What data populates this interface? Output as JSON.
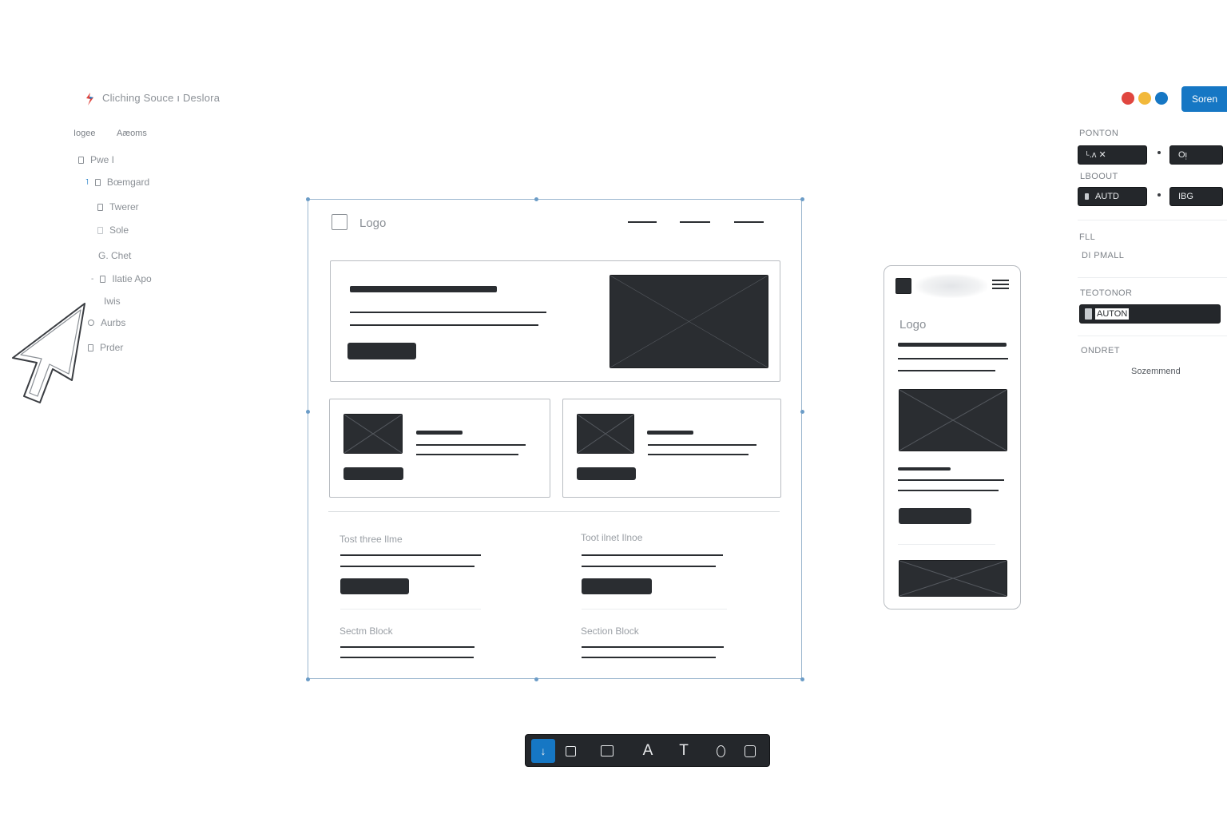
{
  "app": {
    "title": "Cliching Souce ı Deslora",
    "share_label": "Soren",
    "window_dots": [
      "#e0463f",
      "#f2b93b",
      "#1677c4"
    ]
  },
  "left_panel": {
    "tabs": [
      "Iogee",
      "Aæoms"
    ],
    "layers": [
      {
        "label": "Pwe I",
        "icon": "page-icon"
      },
      {
        "label": "Bœmgard",
        "icon": "frame-icon"
      },
      {
        "label": "Twerer",
        "icon": "frame-icon"
      },
      {
        "label": "Sole",
        "icon": "frame-icon"
      },
      {
        "label": "G. Chet",
        "icon": "text-icon"
      },
      {
        "label": "Ilatie Apo",
        "icon": "frame-icon"
      },
      {
        "label": "Iwis",
        "icon": "group-icon"
      },
      {
        "label": "Aurbs",
        "icon": "frame-icon"
      },
      {
        "label": "Prder",
        "icon": "frame-icon"
      }
    ]
  },
  "desktop_frame": {
    "logo": "Logo",
    "section_a": "Tost three Ilme",
    "section_b": "Toot ilnet Ilnoe",
    "block_a": "Sectm Block",
    "block_b": "Section Block"
  },
  "mobile_frame": {
    "logo": "Logo"
  },
  "right_panel": {
    "position_label": "PONTON",
    "position_x": "ᴸ.ᴧ ✕",
    "position_y": "Oᴉ",
    "layout_label": "LBOOUT",
    "layout_mode": "AUTD",
    "layout_value": "IBG",
    "fill_label": "FLL",
    "fill_value": "DI PMALL",
    "text_label": "TEOTONOR",
    "text_value": "AUTON",
    "order_label": "ONDRET",
    "order_value": "Sozemmend"
  },
  "toolbar": {
    "tools": [
      {
        "name": "move-tool",
        "glyph": "↓",
        "active": true
      },
      {
        "name": "frame-tool",
        "glyph": "",
        "active": false
      },
      {
        "name": "rectangle-tool",
        "glyph": "",
        "active": false
      },
      {
        "name": "pen-tool",
        "glyph": "A",
        "active": false
      },
      {
        "name": "text-tool",
        "glyph": "T",
        "active": false
      },
      {
        "name": "ellipse-tool",
        "glyph": "",
        "active": false
      },
      {
        "name": "shape-tool",
        "glyph": "",
        "active": false
      }
    ]
  }
}
